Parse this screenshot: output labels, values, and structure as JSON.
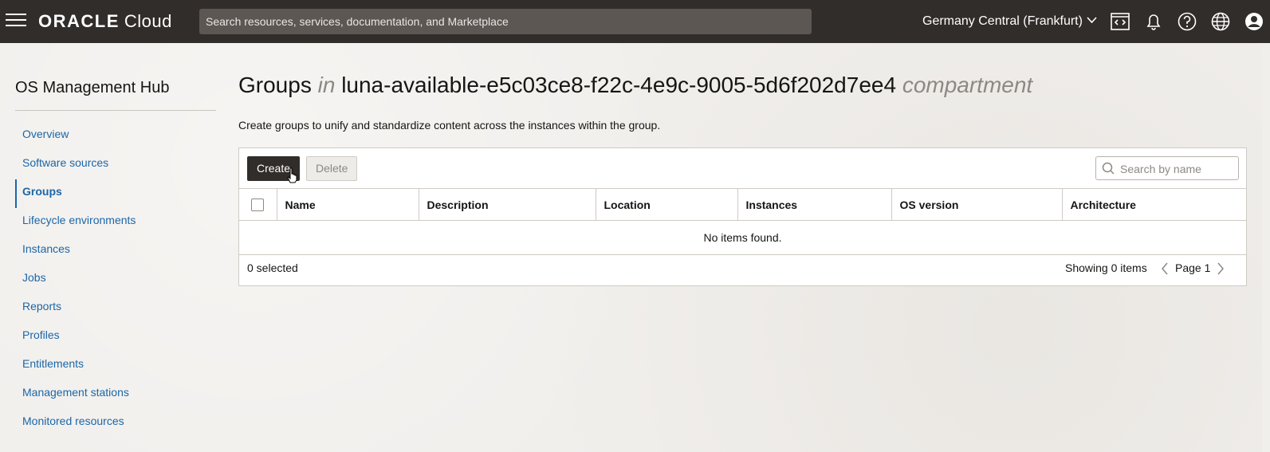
{
  "header": {
    "brand": "ORACLE",
    "product": "Cloud",
    "search_placeholder": "Search resources, services, documentation, and Marketplace",
    "region": "Germany Central (Frankfurt)",
    "icons": [
      "menu-icon",
      "code-editor-icon",
      "bell-icon",
      "help-icon",
      "globe-icon",
      "user-icon"
    ]
  },
  "sidebar": {
    "title": "OS Management Hub",
    "items": [
      {
        "label": "Overview"
      },
      {
        "label": "Software sources"
      },
      {
        "label": "Groups",
        "active": true
      },
      {
        "label": "Lifecycle environments"
      },
      {
        "label": "Instances"
      },
      {
        "label": "Jobs"
      },
      {
        "label": "Reports"
      },
      {
        "label": "Profiles"
      },
      {
        "label": "Entitlements"
      },
      {
        "label": "Management stations"
      },
      {
        "label": "Monitored resources"
      }
    ]
  },
  "main": {
    "title": "Groups",
    "title_in": "in",
    "compartment": "luna-available-e5c03ce8-f22c-4e9c-9005-5d6f202d7ee4",
    "compartment_suffix": "compartment",
    "description": "Create groups to unify and standardize content across the instances within the group.",
    "toolbar": {
      "create_label": "Create",
      "delete_label": "Delete",
      "search_placeholder": "Search by name"
    },
    "table": {
      "columns": [
        "Name",
        "Description",
        "Location",
        "Instances",
        "OS version",
        "Architecture"
      ],
      "empty_text": "No items found."
    },
    "footer": {
      "selected": "0 selected",
      "showing": "Showing 0 items",
      "page": "Page 1"
    }
  },
  "colors": {
    "topbar": "#312d2a",
    "link": "#1c66a8",
    "primary_button": "#312d2a"
  }
}
